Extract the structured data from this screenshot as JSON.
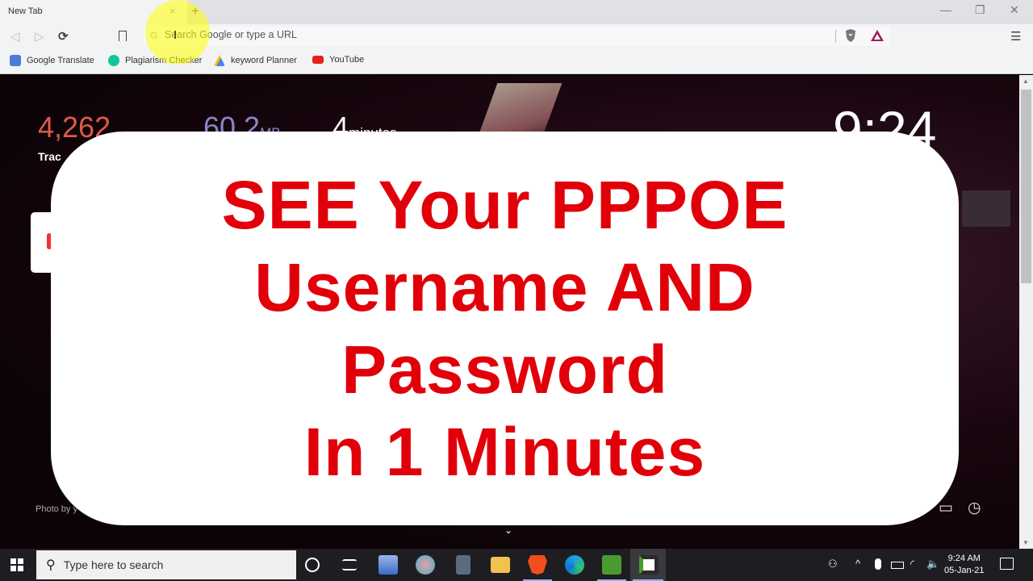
{
  "browser": {
    "tab_title": "New Tab",
    "tab_close": "×",
    "new_tab": "+",
    "window_controls": {
      "minimize": "—",
      "restore": "❐",
      "close": "✕"
    },
    "nav": {
      "back": "◁",
      "forward": "▷",
      "reload": "⟳",
      "bookmark": "🔖",
      "menu": "☰"
    },
    "omnibox": {
      "placeholder": "Search Google or type a URL",
      "value": "",
      "g_icon": "G"
    },
    "bookmarks": [
      {
        "label": "Google Translate",
        "icon": "google-translate-icon",
        "color": "#4a7bd6"
      },
      {
        "label": "Plagiarism Checker",
        "icon": "grammarly-icon",
        "color": "#15c39a"
      },
      {
        "label": "keyword Planner",
        "icon": "google-ads-icon",
        "color": "#fbbc04"
      },
      {
        "label": "YouTube",
        "icon": "youtube-icon",
        "color": "#e62117"
      }
    ]
  },
  "newtab": {
    "trackers_count": "4,262",
    "trackers_label": "Trac",
    "bandwidth_value": "60.2",
    "bandwidth_unit": "MB",
    "time_saved_value": "4",
    "time_saved_unit": "minutes",
    "clock": "9:24",
    "photo_credit": "Photo by y",
    "chevron": "⌄",
    "colors": {
      "trackers": "#e05a4a",
      "bandwidth": "#8b86c8"
    }
  },
  "overlay": {
    "lines": [
      "SEE Your PPPOE",
      "Username AND",
      "Password",
      "In 1 Minutes"
    ],
    "color": "#e1000a"
  },
  "taskbar": {
    "search_placeholder": "Type here to search",
    "search_icon": "⚲",
    "apps": [
      "cortana",
      "task-view",
      "network-settings",
      "snipping-tool",
      "calculator",
      "file-explorer",
      "brave",
      "edge",
      "camtasia",
      "camtasia-recorder"
    ],
    "tray": {
      "chevron": "^",
      "time": "9:24 AM",
      "date": "05-Jan-21"
    }
  }
}
